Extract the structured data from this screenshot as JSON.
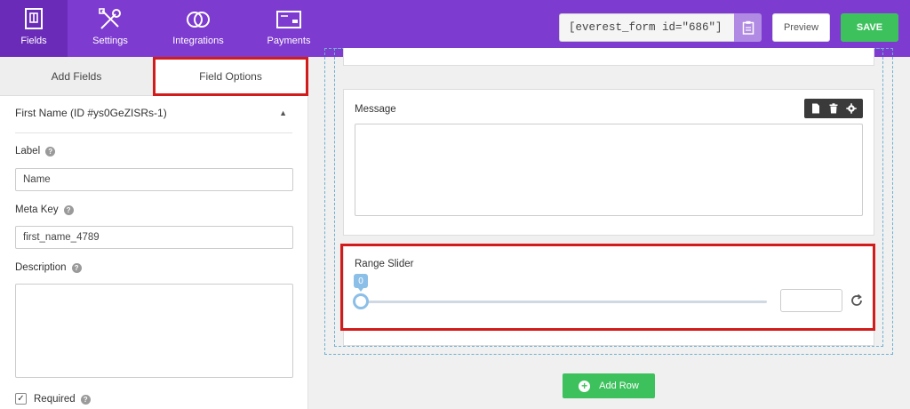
{
  "nav": {
    "items": [
      {
        "label": "Fields",
        "icon": "fields-icon"
      },
      {
        "label": "Settings",
        "icon": "settings-icon"
      },
      {
        "label": "Integrations",
        "icon": "integrations-icon"
      },
      {
        "label": "Payments",
        "icon": "payments-icon"
      }
    ]
  },
  "header": {
    "shortcode": "[everest_form id=\"686\"]",
    "preview_label": "Preview",
    "save_label": "SAVE"
  },
  "left_panel": {
    "tabs": [
      {
        "label": "Add Fields"
      },
      {
        "label": "Field Options"
      }
    ],
    "section_title": "First Name (ID #ys0GeZISRs-1)",
    "label_label": "Label",
    "label_value": "Name",
    "meta_key_label": "Meta Key",
    "meta_key_value": "first_name_4789",
    "description_label": "Description",
    "required_label": "Required"
  },
  "canvas": {
    "message_label": "Message",
    "range_label": "Range Slider",
    "range_value": "0",
    "range_fraction": 0,
    "add_row_label": "Add Row"
  },
  "colors": {
    "brand_purple": "#7e3bd0",
    "save_green": "#3dc15d",
    "highlight_red": "#d21c1c",
    "slider_blue": "#8cbfe8"
  }
}
